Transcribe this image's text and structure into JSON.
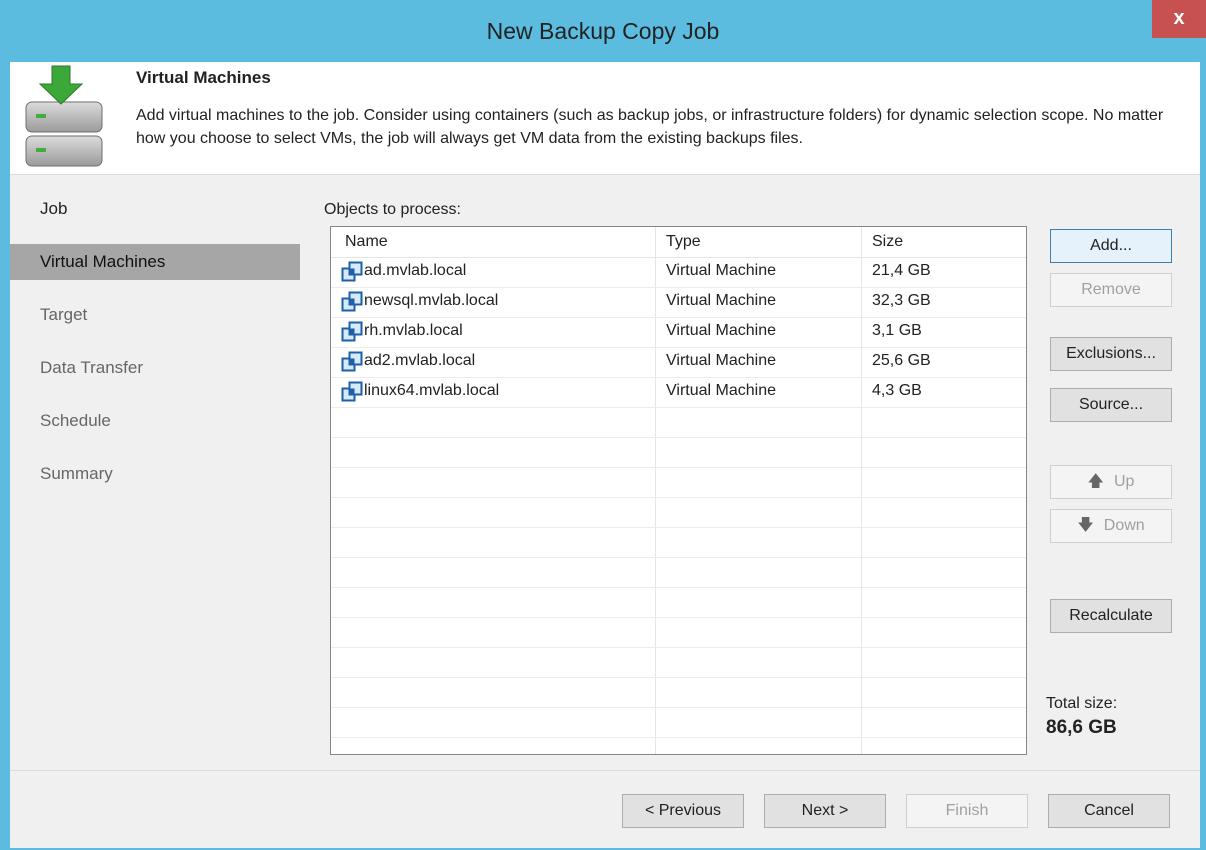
{
  "window": {
    "title": "New Backup Copy Job",
    "close_label": "x"
  },
  "header": {
    "title": "Virtual Machines",
    "description": "Add virtual machines to the job. Consider using containers (such as backup jobs, or infrastructure folders) for dynamic selection scope. No matter how you choose to select VMs, the job will always get VM data from the existing backups files."
  },
  "nav": {
    "items": [
      {
        "label": "Job"
      },
      {
        "label": "Virtual Machines"
      },
      {
        "label": "Target"
      },
      {
        "label": "Data Transfer"
      },
      {
        "label": "Schedule"
      },
      {
        "label": "Summary"
      }
    ]
  },
  "objects": {
    "label": "Objects to process:",
    "columns": [
      "Name",
      "Type",
      "Size"
    ],
    "rows": [
      {
        "name": "ad.mvlab.local",
        "type": "Virtual Machine",
        "size": "21,4 GB"
      },
      {
        "name": "newsql.mvlab.local",
        "type": "Virtual Machine",
        "size": "32,3 GB"
      },
      {
        "name": "rh.mvlab.local",
        "type": "Virtual Machine",
        "size": "3,1 GB"
      },
      {
        "name": "ad2.mvlab.local",
        "type": "Virtual Machine",
        "size": "25,6 GB"
      },
      {
        "name": "linux64.mvlab.local",
        "type": "Virtual Machine",
        "size": "4,3 GB"
      }
    ]
  },
  "side_buttons": {
    "add": "Add...",
    "remove": "Remove",
    "exclusions": "Exclusions...",
    "source": "Source...",
    "up": "Up",
    "down": "Down",
    "recalculate": "Recalculate"
  },
  "total": {
    "label": "Total size:",
    "value": "86,6 GB"
  },
  "footer": {
    "previous": "< Previous",
    "next": "Next >",
    "finish": "Finish",
    "cancel": "Cancel"
  },
  "colors": {
    "titlebar": "#5bbce0",
    "close": "#c75050",
    "nav_active": "#a6a6a6",
    "download_arrow": "#3da83a"
  },
  "icons": {
    "header": "backup-server-download-icon",
    "vm": "virtual-machine-icon",
    "up": "arrow-up-icon",
    "down": "arrow-down-icon"
  }
}
